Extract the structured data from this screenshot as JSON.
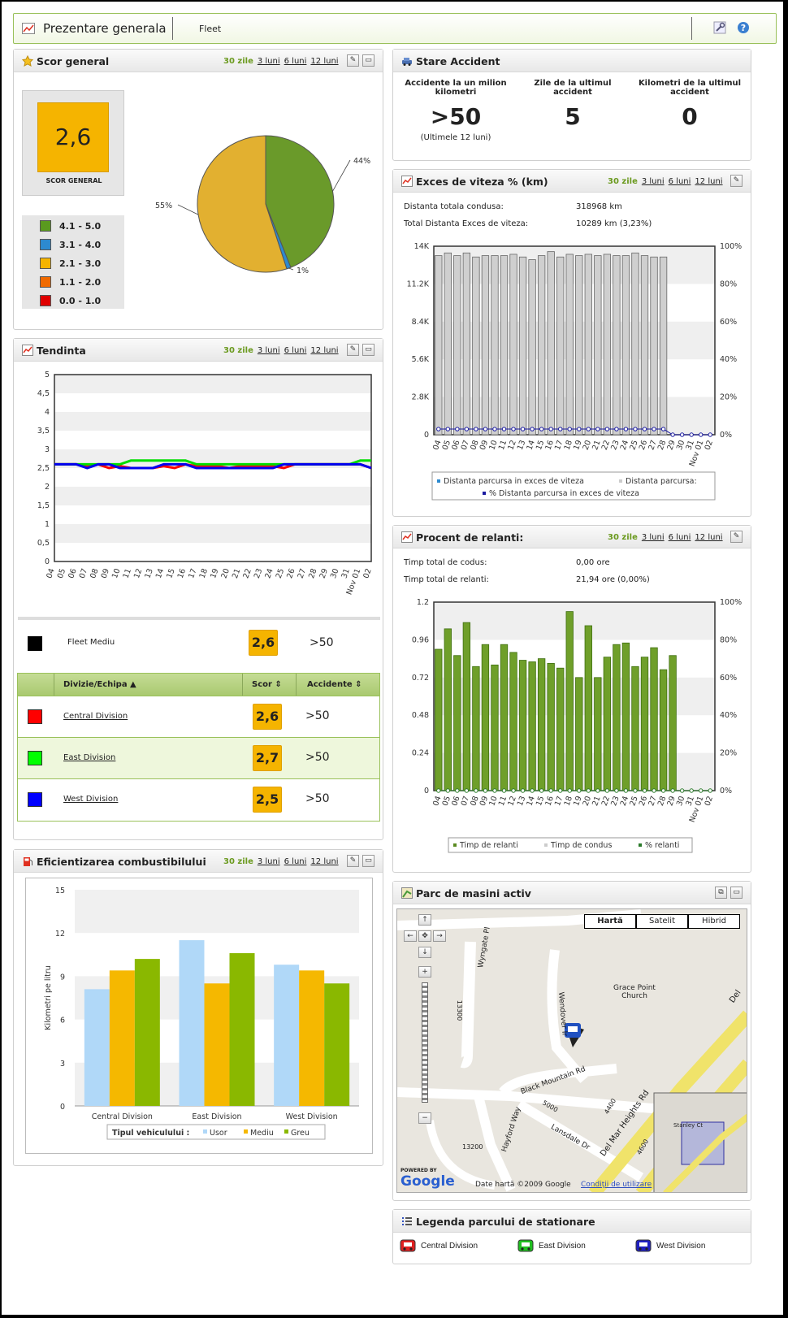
{
  "topbar": {
    "title": "Prezentare generala",
    "subtitle": "Fleet"
  },
  "ranges": {
    "d30": "30 zile",
    "m3": "3 luni",
    "m6": "6 luni",
    "m12": "12 luni"
  },
  "scor_general": {
    "title": "Scor general",
    "value": "2,6",
    "caption": "SCOR GENERAL",
    "legend": [
      {
        "label": "4.1 - 5.0",
        "color": "#5a9a1f"
      },
      {
        "label": "3.1 - 4.0",
        "color": "#2d8ad0"
      },
      {
        "label": "2.1 - 3.0",
        "color": "#f5b400"
      },
      {
        "label": "1.1 - 2.0",
        "color": "#f06a00"
      },
      {
        "label": "0.0 - 1.0",
        "color": "#e00000"
      }
    ],
    "pie": [
      {
        "label": "44%",
        "value": 44,
        "color": "#6a9a2a"
      },
      {
        "label": "1%",
        "value": 1,
        "color": "#2d8ad0"
      },
      {
        "label": "55%",
        "value": 55,
        "color": "#e2b030"
      }
    ]
  },
  "tendinta": {
    "title": "Tendinta",
    "chart_data": {
      "type": "line",
      "ylim": [
        0,
        5
      ],
      "y_ticks": [
        "0",
        "0,5",
        "1",
        "1,5",
        "2",
        "2,5",
        "3",
        "3,5",
        "4",
        "4,5",
        "5"
      ],
      "x": [
        "04",
        "05",
        "06",
        "07",
        "08",
        "09",
        "10",
        "11",
        "12",
        "13",
        "14",
        "15",
        "16",
        "17",
        "18",
        "19",
        "20",
        "21",
        "22",
        "23",
        "24",
        "25",
        "26",
        "27",
        "28",
        "29",
        "30",
        "31",
        "Nov 01",
        "02"
      ],
      "series": [
        {
          "name": "Central Division",
          "color": "#ff0000",
          "values": [
            2.6,
            2.6,
            2.6,
            2.55,
            2.6,
            2.5,
            2.55,
            2.5,
            2.5,
            2.5,
            2.55,
            2.5,
            2.6,
            2.55,
            2.55,
            2.55,
            2.5,
            2.55,
            2.55,
            2.55,
            2.55,
            2.5,
            2.6,
            2.6,
            2.6,
            2.6,
            2.6,
            2.6,
            2.6,
            2.5
          ]
        },
        {
          "name": "East Division",
          "color": "#00dd00",
          "values": [
            2.6,
            2.6,
            2.6,
            2.6,
            2.6,
            2.6,
            2.6,
            2.7,
            2.7,
            2.7,
            2.7,
            2.7,
            2.7,
            2.6,
            2.6,
            2.6,
            2.6,
            2.6,
            2.6,
            2.6,
            2.6,
            2.6,
            2.6,
            2.6,
            2.6,
            2.6,
            2.6,
            2.6,
            2.7,
            2.7
          ]
        },
        {
          "name": "West Division",
          "color": "#0000ee",
          "values": [
            2.6,
            2.6,
            2.6,
            2.5,
            2.6,
            2.6,
            2.5,
            2.5,
            2.5,
            2.5,
            2.6,
            2.6,
            2.6,
            2.5,
            2.5,
            2.5,
            2.5,
            2.5,
            2.5,
            2.5,
            2.5,
            2.6,
            2.6,
            2.6,
            2.6,
            2.6,
            2.6,
            2.6,
            2.6,
            2.5
          ]
        }
      ]
    },
    "fleet": {
      "label": "Fleet Mediu",
      "score": "2,6",
      "accidents": ">50"
    },
    "table": {
      "headers": [
        "Divizie/Echipa",
        "Scor",
        "Accidente"
      ],
      "rows": [
        {
          "name": "Central Division",
          "color": "#ff0000",
          "score": "2,6",
          "accidents": ">50"
        },
        {
          "name": "East Division",
          "color": "#00ff00",
          "score": "2,7",
          "accidents": ">50"
        },
        {
          "name": "West Division",
          "color": "#0000ff",
          "score": "2,5",
          "accidents": ">50"
        }
      ]
    }
  },
  "combustibil": {
    "title": "Eficientizarea combustibilului",
    "chart_data": {
      "type": "bar",
      "ylabel": "Kilometri pe litru",
      "ylim": [
        0,
        15
      ],
      "y_ticks": [
        "0",
        "3",
        "6",
        "9",
        "12",
        "15"
      ],
      "categories": [
        "Central Division",
        "East Division",
        "West Division"
      ],
      "series": [
        {
          "name": "Usor",
          "color": "#b0d8f8",
          "values": [
            8.1,
            11.5,
            9.8
          ]
        },
        {
          "name": "Mediu",
          "color": "#f5b800",
          "values": [
            9.4,
            8.5,
            9.4
          ]
        },
        {
          "name": "Greu",
          "color": "#8ab800",
          "values": [
            10.2,
            10.6,
            8.5
          ]
        }
      ],
      "legend_title": "Tipul vehiculului :"
    }
  },
  "stare_accident": {
    "title": "Stare Accident",
    "cols": [
      {
        "label": "Accidente la un milion kilometri",
        "value": ">50",
        "note": "(Ultimele 12 luni)"
      },
      {
        "label": "Zile de la ultimul accident",
        "value": "5",
        "note": ""
      },
      {
        "label": "Kilometri de la ultimul accident",
        "value": "0",
        "note": ""
      }
    ]
  },
  "exces": {
    "title": "Exces de viteza % (km)",
    "stats": [
      {
        "label": "Distanta totala condusa:",
        "value": "318968 km"
      },
      {
        "label": "Total Distanta Exces de viteza:",
        "value": "10289 km (3,23%)"
      }
    ],
    "chart_data": {
      "type": "bar",
      "ylim": [
        0,
        14000
      ],
      "y_ticks": [
        "0",
        "2.8K",
        "5.6K",
        "8.4K",
        "11.2K",
        "14K"
      ],
      "y2_ticks": [
        "0%",
        "20%",
        "40%",
        "60%",
        "80%",
        "100%"
      ],
      "x": [
        "04",
        "05",
        "06",
        "07",
        "08",
        "09",
        "10",
        "11",
        "12",
        "13",
        "14",
        "15",
        "16",
        "17",
        "18",
        "19",
        "20",
        "21",
        "22",
        "23",
        "24",
        "25",
        "26",
        "27",
        "28",
        "29",
        "30",
        "31",
        "Nov 01",
        "02"
      ],
      "series": [
        {
          "name": "Distanta parcursa:",
          "values": [
            13300,
            13500,
            13300,
            13500,
            13200,
            13300,
            13300,
            13300,
            13400,
            13200,
            13000,
            13300,
            13600,
            13200,
            13400,
            13300,
            13400,
            13300,
            13400,
            13300,
            13300,
            13500,
            13300,
            13200,
            13200,
            0,
            0,
            0,
            0,
            0
          ]
        },
        {
          "name": "Distanta parcursa in exces de viteza",
          "values": [
            400,
            400,
            400,
            400,
            400,
            400,
            400,
            400,
            400,
            400,
            400,
            400,
            400,
            400,
            400,
            400,
            400,
            400,
            400,
            400,
            400,
            400,
            400,
            400,
            400,
            0,
            0,
            0,
            0,
            0
          ]
        },
        {
          "name": "% Distanta parcursa in exces de viteza",
          "values": [
            3,
            3,
            3,
            3,
            3,
            3,
            3,
            3,
            3,
            3,
            3,
            3,
            3,
            3,
            3,
            3,
            3,
            3,
            3,
            3,
            3,
            3,
            3,
            3,
            3,
            0,
            0,
            0,
            0,
            0
          ]
        }
      ],
      "legend": [
        "Distanta parcursa in exces de viteza",
        "Distanta parcursa:",
        "% Distanta parcursa in exces de viteza"
      ]
    }
  },
  "relanti": {
    "title": "Procent de relanti:",
    "stats": [
      {
        "label": "Timp total de codus:",
        "value": "0,00 ore"
      },
      {
        "label": "Timp total de relanti:",
        "value": "21,94 ore (0,00%)"
      }
    ],
    "chart_data": {
      "type": "bar",
      "ylim": [
        0,
        1.2
      ],
      "y_ticks": [
        "0",
        "0.24",
        "0.48",
        "0.72",
        "0.96",
        "1.2"
      ],
      "y2_ticks": [
        "0%",
        "20%",
        "40%",
        "60%",
        "80%",
        "100%"
      ],
      "x": [
        "04",
        "05",
        "06",
        "07",
        "08",
        "09",
        "10",
        "11",
        "12",
        "13",
        "14",
        "15",
        "16",
        "17",
        "18",
        "19",
        "20",
        "21",
        "22",
        "23",
        "24",
        "25",
        "26",
        "27",
        "28",
        "29",
        "30",
        "31",
        "Nov 01",
        "02"
      ],
      "series": [
        {
          "name": "Timp de relanti",
          "values": [
            0.9,
            1.03,
            0.86,
            1.07,
            0.79,
            0.93,
            0.8,
            0.93,
            0.88,
            0.83,
            0.82,
            0.84,
            0.81,
            0.78,
            1.14,
            0.72,
            1.05,
            0.72,
            0.85,
            0.93,
            0.94,
            0.79,
            0.85,
            0.91,
            0.77,
            0.86,
            0,
            0,
            0,
            0
          ]
        },
        {
          "name": "Timp de condus",
          "values": [
            0,
            0,
            0,
            0,
            0,
            0,
            0,
            0,
            0,
            0,
            0,
            0,
            0,
            0,
            0,
            0,
            0,
            0,
            0,
            0,
            0,
            0,
            0,
            0,
            0,
            0,
            0,
            0,
            0,
            0
          ]
        },
        {
          "name": "% relanti",
          "values": [
            0,
            0,
            0,
            0,
            0,
            0,
            0,
            0,
            0,
            0,
            0,
            0,
            0,
            0,
            0,
            0,
            0,
            0,
            0,
            0,
            0,
            0,
            0,
            0,
            0,
            0,
            0,
            0,
            0,
            0
          ]
        }
      ],
      "legend": [
        "Timp de relanti",
        "Timp de condus",
        "% relanti"
      ]
    }
  },
  "parc": {
    "title": "Parc de masini activ",
    "map_types": [
      "Hartă",
      "Satelit",
      "Hibrid"
    ],
    "streets": [
      "Wyngate Pl",
      "Wendover Ir",
      "Black Mountain Rd",
      "Del Mar Heights Rd",
      "Hayford Way",
      "Lansdale Dr",
      "Grace Point Church",
      "13300",
      "13200",
      "5000",
      "4400",
      "4600",
      "Del",
      "Stanley Ct"
    ],
    "attribution": "Date hartă ©2009 Google",
    "terms": "Condiţii de utilizare",
    "powered": "POWERED BY",
    "google": "Google"
  },
  "legenda": {
    "title": "Legenda parcului de stationare",
    "items": [
      {
        "label": "Central Division",
        "color": "#e02020"
      },
      {
        "label": "East Division",
        "color": "#20c020"
      },
      {
        "label": "West Division",
        "color": "#2020c0"
      }
    ]
  }
}
